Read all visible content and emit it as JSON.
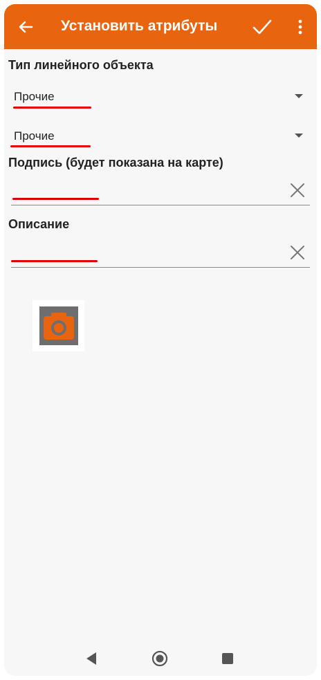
{
  "toolbar": {
    "title": "Установить атрибуты",
    "back_icon": "arrow-left-icon",
    "confirm_icon": "check-icon",
    "menu_icon": "more-vert-icon",
    "background_color": "#e8640f"
  },
  "line_type": {
    "label": "Тип линейного объекта",
    "spinner1_value": "Прочие",
    "spinner2_value": "Прочие"
  },
  "caption": {
    "label": "Подпись (будет показана на карте)",
    "value": ""
  },
  "description": {
    "label": "Описание",
    "value": ""
  },
  "photo": {
    "icon": "camera-icon"
  },
  "nav": {
    "back_icon": "triangle-back-icon",
    "home_icon": "circle-home-icon",
    "recents_icon": "square-recents-icon"
  },
  "annotation_color": "#e00000"
}
